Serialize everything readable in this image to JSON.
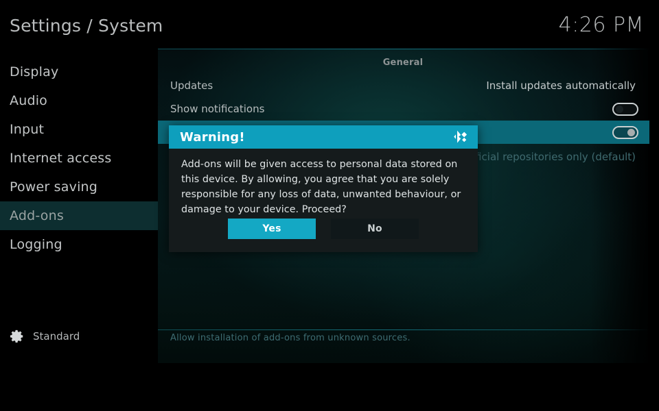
{
  "header": {
    "title": "Settings / System",
    "clock": "4:26 PM"
  },
  "sidebar": {
    "items": [
      {
        "label": "Display",
        "selected": false
      },
      {
        "label": "Audio",
        "selected": false
      },
      {
        "label": "Input",
        "selected": false
      },
      {
        "label": "Internet access",
        "selected": false
      },
      {
        "label": "Power saving",
        "selected": false
      },
      {
        "label": "Add-ons",
        "selected": true
      },
      {
        "label": "Logging",
        "selected": false
      }
    ],
    "profile": {
      "icon": "gear-icon",
      "label": "Standard"
    }
  },
  "main": {
    "section_title": "General",
    "rows": [
      {
        "label": "Updates",
        "value": "Install updates automatically",
        "control": "text"
      },
      {
        "label": "Show notifications",
        "value": "",
        "control": "toggle",
        "toggle_state": "off"
      },
      {
        "label": "",
        "value": "",
        "control": "toggle",
        "toggle_state": "on",
        "highlighted": true
      },
      {
        "label": "",
        "value": "Official repositories only (default)",
        "control": "text",
        "dim": true
      }
    ],
    "help_text": "Allow installation of add-ons from unknown sources."
  },
  "dialog": {
    "title": "Warning!",
    "logo": "kodi-logo-icon",
    "message": "Add-ons will be given access to personal data stored on this device. By allowing, you agree that you are solely responsible for any loss of data, unwanted behaviour, or damage to your device. Proceed?",
    "buttons": {
      "yes": "Yes",
      "no": "No"
    }
  },
  "colors": {
    "accent": "#0e9fbd",
    "button_primary": "#14a8c4",
    "row_highlight": "#0b6878",
    "sidebar_highlight": "#0d2e30",
    "dialog_bg": "#151b1c"
  }
}
